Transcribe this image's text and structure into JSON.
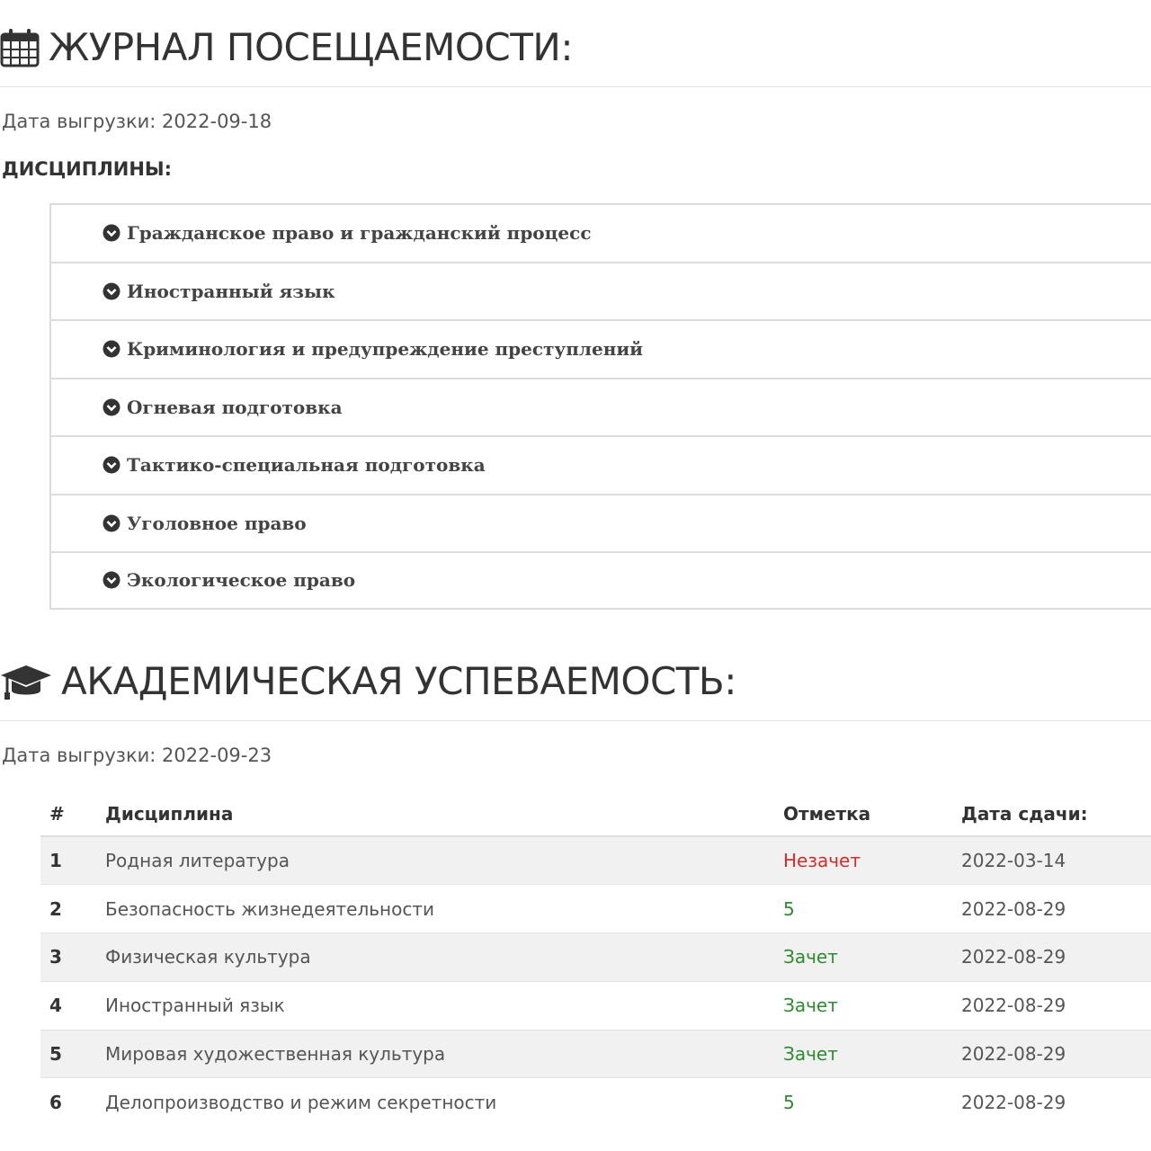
{
  "attendance": {
    "title": "ЖУРНАЛ ПОСЕЩАЕМОСТИ:",
    "icon": "calendar-icon",
    "export_label": "Дата выгрузки: 2022-09-18",
    "disciplines_heading": "ДИСЦИПЛИНЫ:",
    "disciplines": [
      "Гражданское право и гражданский процесс",
      "Иностранный язык",
      "Криминология и предупреждение преступлений",
      "Огневая подготовка",
      "Тактико-специальная подготовка",
      "Уголовное право",
      "Экологическое право"
    ]
  },
  "performance": {
    "title": "АКАДЕМИЧЕСКАЯ УСПЕВАЕМОСТЬ:",
    "icon": "graduation-cap-icon",
    "export_label": "Дата выгрузки: 2022-09-23",
    "columns": {
      "num": "#",
      "discipline": "Дисциплина",
      "mark": "Отметка",
      "date": "Дата сдачи:"
    },
    "rows": [
      {
        "num": "1",
        "discipline": "Родная литература",
        "mark": "Незачет",
        "date": "2022-03-14"
      },
      {
        "num": "2",
        "discipline": "Безопасность жизнедеятельности",
        "mark": "5",
        "date": "2022-08-29"
      },
      {
        "num": "3",
        "discipline": "Физическая культура",
        "mark": "Зачет",
        "date": "2022-08-29"
      },
      {
        "num": "4",
        "discipline": "Иностранный язык",
        "mark": "Зачет",
        "date": "2022-08-29"
      },
      {
        "num": "5",
        "discipline": "Мировая художественная культура",
        "mark": "Зачет",
        "date": "2022-08-29"
      },
      {
        "num": "6",
        "discipline": "Делопроизводство и режим секретности",
        "mark": "5",
        "date": "2022-08-29"
      }
    ]
  },
  "colors": {
    "fail": "#d62b2b",
    "pass": "#2e8b2e",
    "row_stripe": "#f1f1f1"
  }
}
